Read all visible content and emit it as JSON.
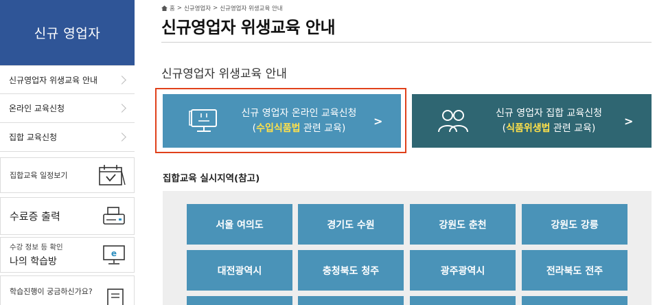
{
  "sidebar": {
    "title": "신규 영업자",
    "links": [
      {
        "label": "신규영업자 위생교육 안내"
      },
      {
        "label": "온라인 교육신청"
      },
      {
        "label": "집합 교육신청"
      }
    ],
    "boxes": {
      "schedule": {
        "label": "집합교육 일정보기",
        "icon": "calendar-check-icon"
      },
      "certificate": {
        "label": "수료증 출력",
        "icon": "printer-icon"
      },
      "my_study": {
        "small": "수강 정보 등 확인",
        "label": "나의 학습방",
        "icon": "monitor-e-icon"
      },
      "help": {
        "label": "학습진행이 궁금하신가요?",
        "icon": "document-icon"
      }
    }
  },
  "breadcrumb": {
    "home": "홈",
    "level1": "신규영업자",
    "level2": "신규영업자 위생교육 안내",
    "sep": ">"
  },
  "page_title": "신규영업자 위생교육 안내",
  "section_title": "신규영업자 위생교육 안내",
  "online_button": {
    "line1": "신규 영업자 온라인 교육신청",
    "open_paren": "(",
    "highlight": "수입식품법",
    "rest": " 관련 교육)",
    "arrow": ">",
    "icon": "monitor-icon"
  },
  "group_button": {
    "line1": "신규 영업자 집합 교육신청",
    "open_paren": "(",
    "highlight": "식품위생법",
    "rest": " 관련 교육)",
    "arrow": ">",
    "icon": "people-icon"
  },
  "regions_title": "집합교육 실시지역(참고)",
  "regions": [
    "서울 여의도",
    "경기도 수원",
    "강원도 춘천",
    "강원도 강릉",
    "대전광역시",
    "충청북도 청주",
    "광주광역시",
    "전라북도 전주",
    "",
    "",
    "",
    ""
  ],
  "colors": {
    "sidebar_header": "#2f5597",
    "online_button": "#4a93b8",
    "group_button": "#2f6672",
    "highlight": "#ffe14a",
    "focus_border": "#e0401a"
  }
}
